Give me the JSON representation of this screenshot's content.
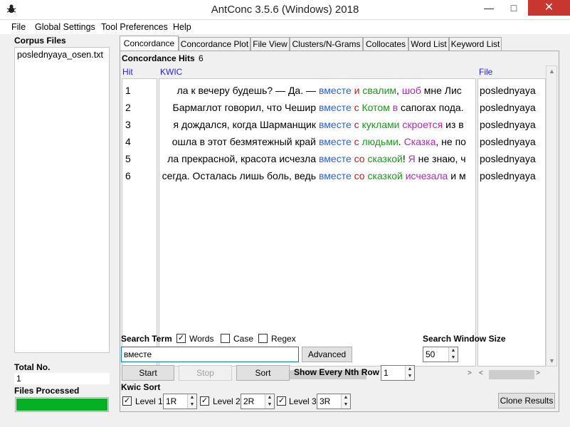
{
  "window": {
    "title": "AntConc 3.5.6 (Windows) 2018",
    "minimize": "—",
    "maximize": "□",
    "close": "✕"
  },
  "menu": [
    "File",
    "Global Settings",
    "Tool Preferences",
    "Help"
  ],
  "left_panel": {
    "corpus_files_label": "Corpus Files",
    "files": [
      "poslednyaya_osen.txt"
    ],
    "total_label": "Total No.",
    "total_value": "1",
    "processed_label": "Files Processed",
    "progress_fraction": 1.0,
    "progress_color": "#06b025"
  },
  "tabs": [
    "Concordance",
    "Concordance Plot",
    "File View",
    "Clusters/N-Grams",
    "Collocates",
    "Word List",
    "Keyword List"
  ],
  "active_tab": "Concordance",
  "concordance": {
    "hits_label": "Concordance Hits",
    "hits_count": "6",
    "columns": {
      "hit": "Hit",
      "kwic": "KWIC",
      "file": "File"
    },
    "rows": [
      {
        "hit": "1",
        "left": "ла к вечеру будешь? — Да. —",
        "right": [
          {
            "t": "вместе",
            "c": "c-blue"
          },
          {
            "t": " "
          },
          {
            "t": "и",
            "c": "c-red"
          },
          {
            "t": " "
          },
          {
            "t": "свалим",
            "c": "c-green"
          },
          {
            "t": ", "
          },
          {
            "t": "шоб",
            "c": "c-mag"
          },
          {
            "t": " мне Лис"
          }
        ],
        "file": "poslednyaya"
      },
      {
        "hit": "2",
        "left": "Бармаглот говорил, что Чешир",
        "right": [
          {
            "t": "вместе",
            "c": "c-blue"
          },
          {
            "t": " "
          },
          {
            "t": "с",
            "c": "c-red"
          },
          {
            "t": " "
          },
          {
            "t": "Котом",
            "c": "c-green"
          },
          {
            "t": " "
          },
          {
            "t": "в",
            "c": "c-mag"
          },
          {
            "t": " сапогах пода."
          }
        ],
        "file": "poslednyaya"
      },
      {
        "hit": "3",
        "left": "я дождался, когда Шарманщик",
        "right": [
          {
            "t": "вместе",
            "c": "c-blue"
          },
          {
            "t": " "
          },
          {
            "t": "с",
            "c": "c-red"
          },
          {
            "t": " "
          },
          {
            "t": "куклами",
            "c": "c-green"
          },
          {
            "t": " "
          },
          {
            "t": "скроется",
            "c": "c-mag"
          },
          {
            "t": " из в"
          }
        ],
        "file": "poslednyaya"
      },
      {
        "hit": "4",
        "left": "ошла в этот безмятежный край",
        "right": [
          {
            "t": "вместе",
            "c": "c-blue"
          },
          {
            "t": " "
          },
          {
            "t": "с",
            "c": "c-red"
          },
          {
            "t": " "
          },
          {
            "t": "людьми",
            "c": "c-green"
          },
          {
            "t": ". "
          },
          {
            "t": "Сказка",
            "c": "c-mag"
          },
          {
            "t": ", не по"
          }
        ],
        "file": "poslednyaya"
      },
      {
        "hit": "5",
        "left": "ла прекрасной, красота исчезла",
        "right": [
          {
            "t": "вместе",
            "c": "c-blue"
          },
          {
            "t": " "
          },
          {
            "t": "со",
            "c": "c-red"
          },
          {
            "t": " "
          },
          {
            "t": "сказкой",
            "c": "c-green"
          },
          {
            "t": "! "
          },
          {
            "t": "Я",
            "c": "c-mag"
          },
          {
            "t": " не знаю, ч"
          }
        ],
        "file": "poslednyaya"
      },
      {
        "hit": "6",
        "left": "сегда. Осталась лишь боль, ведь",
        "right": [
          {
            "t": "вместе",
            "c": "c-blue"
          },
          {
            "t": " "
          },
          {
            "t": "со",
            "c": "c-red"
          },
          {
            "t": " "
          },
          {
            "t": "сказкой",
            "c": "c-green"
          },
          {
            "t": " "
          },
          {
            "t": "исчезала",
            "c": "c-mag"
          },
          {
            "t": " и м"
          }
        ],
        "file": "poslednyaya"
      }
    ]
  },
  "search": {
    "term_label": "Search Term",
    "words_label": "Words",
    "words_checked": true,
    "case_label": "Case",
    "case_checked": false,
    "regex_label": "Regex",
    "regex_checked": false,
    "value": "вместе",
    "advanced_label": "Advanced",
    "start_label": "Start",
    "stop_label": "Stop",
    "sort_label": "Sort",
    "nth_row_label": "Show Every Nth Row",
    "nth_row_value": "1",
    "window_size_label": "Search Window Size",
    "window_size_value": "50"
  },
  "kwic_sort": {
    "label": "Kwic Sort",
    "levels": [
      {
        "label": "Level 1",
        "value": "1R",
        "checked": true
      },
      {
        "label": "Level 2",
        "value": "2R",
        "checked": true
      },
      {
        "label": "Level 3",
        "value": "3R",
        "checked": true
      }
    ]
  },
  "clone_label": "Clone Results"
}
